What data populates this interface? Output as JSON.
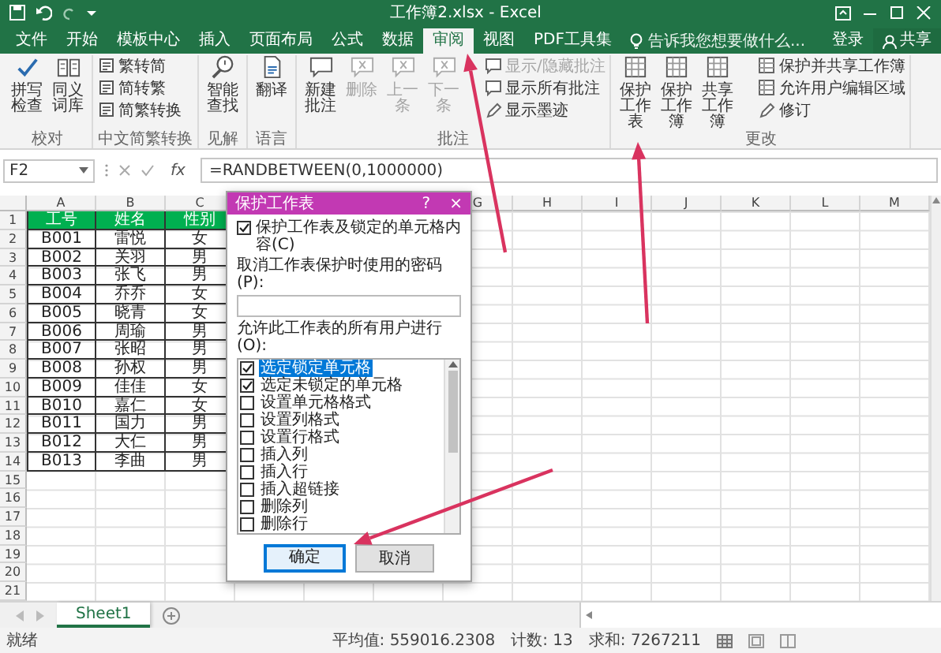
{
  "window": {
    "title": "工作簿2.xlsx - Excel"
  },
  "ribbon_tabs": [
    {
      "label": "文件",
      "selected": false
    },
    {
      "label": "开始",
      "selected": false
    },
    {
      "label": "模板中心",
      "selected": false
    },
    {
      "label": "插入",
      "selected": false
    },
    {
      "label": "页面布局",
      "selected": false
    },
    {
      "label": "公式",
      "selected": false
    },
    {
      "label": "数据",
      "selected": false
    },
    {
      "label": "审阅",
      "selected": true
    },
    {
      "label": "视图",
      "selected": false
    },
    {
      "label": "PDF工具集",
      "selected": false
    }
  ],
  "tell_me": {
    "placeholder": "告诉我您想要做什么..."
  },
  "account": {
    "sign_in": "登录",
    "share": "共享"
  },
  "ribbon_groups": [
    {
      "label": "校对",
      "items": [
        {
          "kind": "large",
          "label": "拼写检查",
          "disabled": false
        },
        {
          "kind": "large",
          "label": "同义词库",
          "disabled": false
        }
      ]
    },
    {
      "label": "中文简繁转换",
      "items": [
        {
          "kind": "small",
          "label": "繁转简",
          "disabled": false
        },
        {
          "kind": "small",
          "label": "简转繁",
          "disabled": false
        },
        {
          "kind": "small",
          "label": "简繁转换",
          "disabled": false
        }
      ]
    },
    {
      "label": "见解",
      "items": [
        {
          "kind": "large",
          "label": "智能查找",
          "disabled": false
        }
      ]
    },
    {
      "label": "语言",
      "items": [
        {
          "kind": "large",
          "label": "翻译",
          "disabled": false
        }
      ]
    },
    {
      "label": "批注",
      "items": [
        {
          "kind": "large",
          "label": "新建批注",
          "disabled": false
        },
        {
          "kind": "large",
          "label": "删除",
          "disabled": true
        },
        {
          "kind": "large",
          "label": "上一条",
          "disabled": true
        },
        {
          "kind": "large",
          "label": "下一条",
          "disabled": true
        },
        {
          "kind": "small",
          "label": "显示/隐藏批注",
          "disabled": true
        },
        {
          "kind": "small",
          "label": "显示所有批注",
          "disabled": false
        },
        {
          "kind": "small",
          "label": "显示墨迹",
          "disabled": false
        }
      ]
    },
    {
      "label": "更改",
      "items": [
        {
          "kind": "large",
          "label": "保护工作表",
          "disabled": false
        },
        {
          "kind": "large",
          "label": "保护工作簿",
          "disabled": false
        },
        {
          "kind": "large",
          "label": "共享工作簿",
          "disabled": false
        },
        {
          "kind": "small",
          "label": "保护并共享工作簿",
          "disabled": false
        },
        {
          "kind": "small",
          "label": "允许用户编辑区域",
          "disabled": false
        },
        {
          "kind": "small",
          "label": "修订",
          "disabled": false
        }
      ]
    }
  ],
  "formula_bar": {
    "name_box": "F2",
    "function_label": "fx",
    "formula": "=RANDBETWEEN(0,1000000)"
  },
  "sheet": {
    "columns_left": [
      "A",
      "B",
      "C"
    ],
    "columns_right": [
      "G",
      "H",
      "I",
      "J",
      "K",
      "L",
      "M"
    ],
    "row_headers": [
      "1",
      "2",
      "3",
      "4",
      "5",
      "6",
      "7",
      "8",
      "9",
      "10",
      "11",
      "12",
      "13",
      "14",
      "15",
      "16",
      "17",
      "18",
      "19",
      "20",
      "21"
    ],
    "header_row": [
      "工号",
      "姓名",
      "性别"
    ],
    "rows": [
      [
        "B001",
        "雷悦",
        "女"
      ],
      [
        "B002",
        "关羽",
        "男"
      ],
      [
        "B003",
        "张飞",
        "男"
      ],
      [
        "B004",
        "乔乔",
        "女"
      ],
      [
        "B005",
        "晓青",
        "女"
      ],
      [
        "B006",
        "周瑜",
        "男"
      ],
      [
        "B007",
        "张昭",
        "男"
      ],
      [
        "B008",
        "孙权",
        "男"
      ],
      [
        "B009",
        "佳佳",
        "女"
      ],
      [
        "B010",
        "嘉仁",
        "女"
      ],
      [
        "B011",
        "国力",
        "男"
      ],
      [
        "B012",
        "大仁",
        "男"
      ],
      [
        "B013",
        "李曲",
        "男"
      ]
    ]
  },
  "sheet_tabs": [
    {
      "label": "Sheet1",
      "selected": true
    }
  ],
  "status_bar": {
    "mode": "就绪",
    "average": "平均值: 559016.2308",
    "count": "计数: 13",
    "sum": "求和: 7267211"
  },
  "dialog": {
    "title": "保护工作表",
    "help": "?",
    "close": "×",
    "protect": {
      "label": "保护工作表及锁定的单元格内容(C)",
      "checked": true
    },
    "password_label": "取消工作表保护时使用的密码(P):",
    "allow_label": "允许此工作表的所有用户进行(O):",
    "permissions": [
      {
        "label": "选定锁定单元格",
        "checked": true,
        "selected": true
      },
      {
        "label": "选定未锁定的单元格",
        "checked": true,
        "selected": false
      },
      {
        "label": "设置单元格格式",
        "checked": false,
        "selected": false
      },
      {
        "label": "设置列格式",
        "checked": false,
        "selected": false
      },
      {
        "label": "设置行格式",
        "checked": false,
        "selected": false
      },
      {
        "label": "插入列",
        "checked": false,
        "selected": false
      },
      {
        "label": "插入行",
        "checked": false,
        "selected": false
      },
      {
        "label": "插入超链接",
        "checked": false,
        "selected": false
      },
      {
        "label": "删除列",
        "checked": false,
        "selected": false
      },
      {
        "label": "删除行",
        "checked": false,
        "selected": false
      }
    ],
    "buttons": [
      {
        "label": "确定",
        "default": true
      },
      {
        "label": "取消",
        "default": false
      }
    ]
  }
}
